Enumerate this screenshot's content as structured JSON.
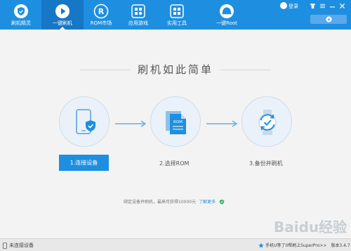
{
  "nav": {
    "items": [
      {
        "label": "刷机精灵",
        "icon": "shield-icon"
      },
      {
        "label": "一键刷机",
        "icon": "play-icon",
        "active": true
      },
      {
        "label": "ROM市场",
        "icon": "rom-r-icon"
      },
      {
        "label": "应用游戏",
        "icon": "apps-grid-icon"
      },
      {
        "label": "实用工具",
        "icon": "tools-grid-icon"
      },
      {
        "label": "一键Root",
        "icon": "root-helmet-icon"
      }
    ]
  },
  "topbar": {
    "login_label": "登录"
  },
  "main": {
    "title": "刷机如此简单",
    "steps": [
      {
        "label": "1.连接设备",
        "icon": "phone-shield-icon"
      },
      {
        "label": "2.选择ROM",
        "icon": "rom-file-icon",
        "icon_text": "ROM"
      },
      {
        "label": "3.备份并刷机",
        "icon": "backup-refresh-icon"
      }
    ],
    "hint_text": "绑定设备并刷机，最高可获得10000元",
    "hint_link": "了解更多"
  },
  "statusbar": {
    "left_text": "未连接设备",
    "right_text": "手机U等了0帮刷上SuperPro>>",
    "version": "版本3.4.7"
  },
  "watermark": {
    "text": "Baidu经验"
  },
  "colors": {
    "brand_blue": "#1e8fe0",
    "active_tab": "#1677c6",
    "background": "#f3f3f3"
  }
}
